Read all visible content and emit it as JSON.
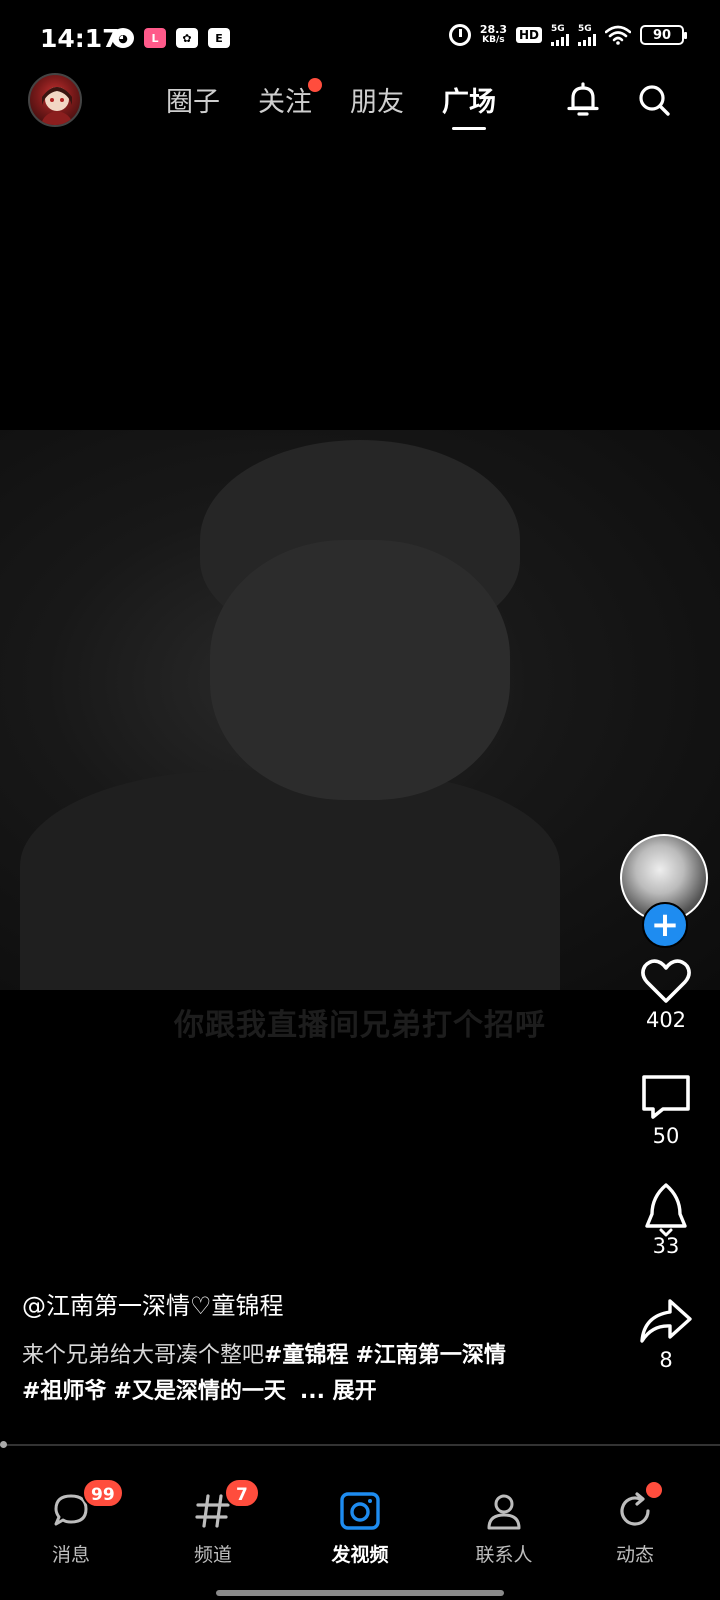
{
  "status_bar": {
    "time": "14:17",
    "app_icons": [
      "bilibili-tv-icon",
      "lofter-icon",
      "flower-app-icon",
      "browser-app-icon"
    ],
    "network_speed_value": "28.3",
    "network_speed_unit": "KB/s",
    "hd_label": "HD",
    "sim1_label": "5G",
    "sim2_label": "5G",
    "battery": "90"
  },
  "top_nav": {
    "tabs": [
      {
        "label": "圈子",
        "active": false,
        "has_dot": false
      },
      {
        "label": "关注",
        "active": false,
        "has_dot": true
      },
      {
        "label": "朋友",
        "active": false,
        "has_dot": false
      },
      {
        "label": "广场",
        "active": true,
        "has_dot": false
      }
    ],
    "icons": [
      "bell-icon",
      "search-icon"
    ]
  },
  "video": {
    "subtitle": "你跟我直播间兄弟打个招呼"
  },
  "actions": {
    "likes": "402",
    "comments": "50",
    "shares_rocket": "33",
    "forwards": "8"
  },
  "post": {
    "author": "@江南第一深情♡童锦程",
    "caption_text": "来个兄弟给大哥凑个整吧",
    "hashtags": [
      "#童锦程",
      "#江南第一深情",
      "#祖师爷",
      "#又是深情的一天"
    ],
    "expand_label": "... 展开"
  },
  "bottom_nav": {
    "items": [
      {
        "label": "消息",
        "icon": "chat-bubble-icon",
        "badge": "99",
        "active": false
      },
      {
        "label": "频道",
        "icon": "hashtag-icon",
        "badge": "7",
        "active": false
      },
      {
        "label": "发视频",
        "icon": "camera-icon",
        "badge": "",
        "active": true
      },
      {
        "label": "联系人",
        "icon": "person-icon",
        "badge": "",
        "active": false
      },
      {
        "label": "动态",
        "icon": "refresh-icon",
        "badge": "",
        "active": false
      }
    ]
  },
  "colors": {
    "background": "#000000",
    "accent_red": "#ff4d3d",
    "accent_blue": "#1e8cf0"
  }
}
